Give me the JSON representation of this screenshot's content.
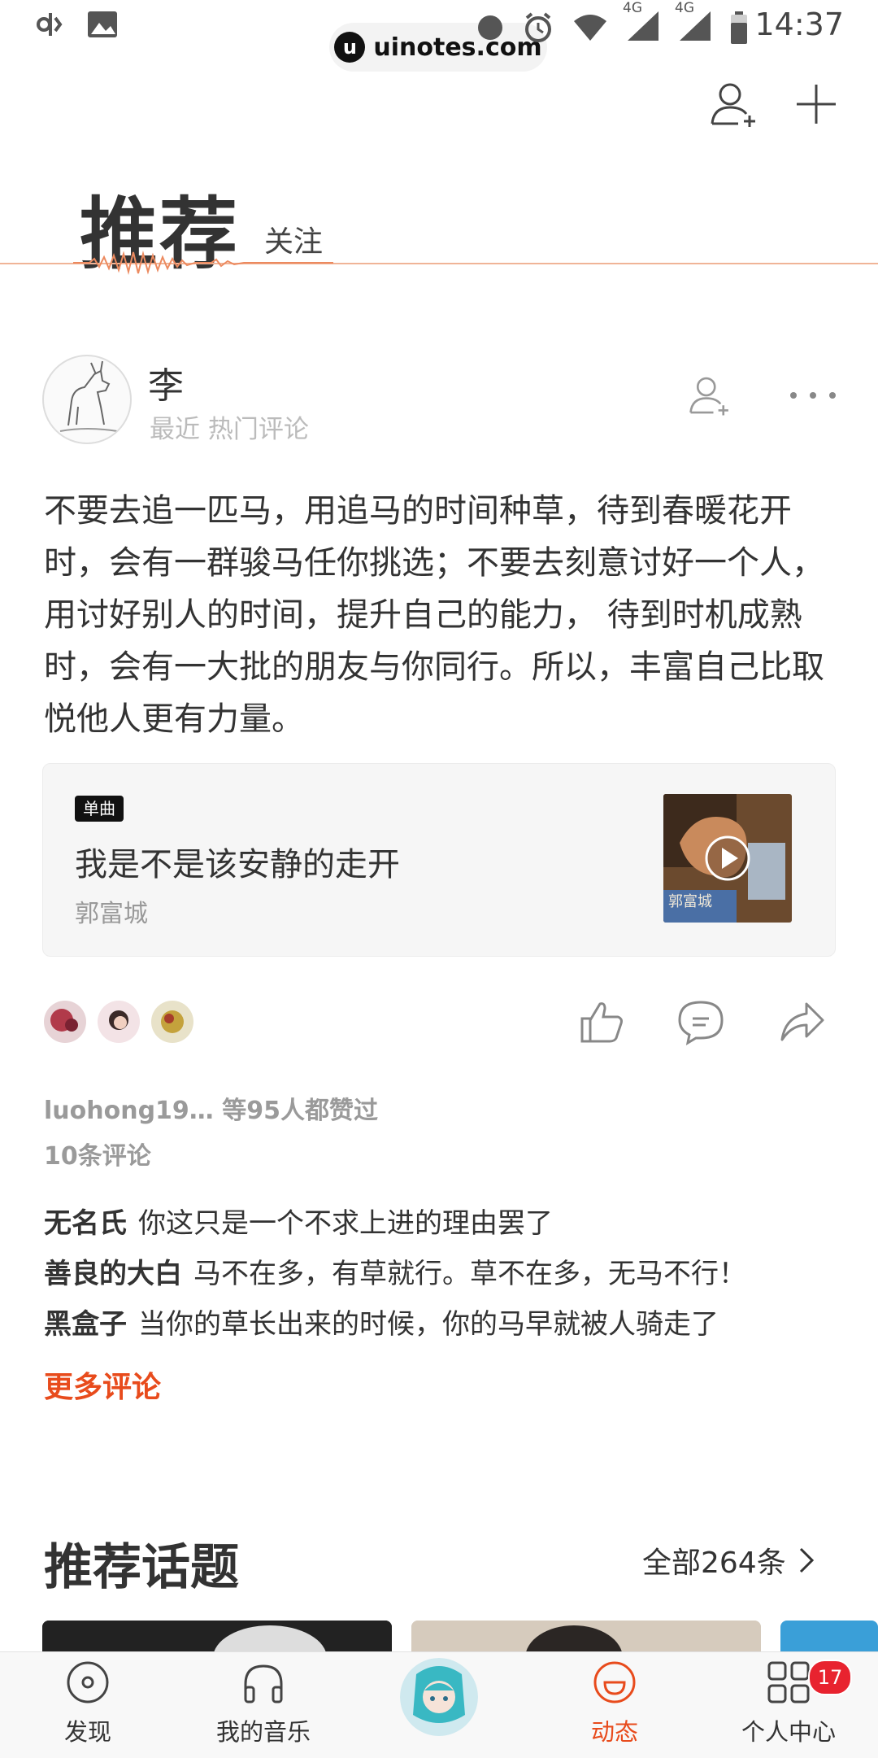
{
  "status_bar": {
    "time": "14:37",
    "network_1": "4G",
    "network_2": "4G",
    "watermark": "uinotes.com",
    "icons": [
      "voicemail-icon",
      "image-icon",
      "moon-icon",
      "alarm-icon",
      "wifi-icon",
      "signal-icon",
      "battery-icon"
    ]
  },
  "header": {
    "add_friend_icon": "add-user-icon",
    "add_icon": "plus-icon"
  },
  "tabs": {
    "active": "推荐",
    "inactive": "关注"
  },
  "post": {
    "username": "李",
    "meta": "最近 热门评论",
    "text": "不要去追一匹马，用追马的时间种草，待到春暖花开时，会有一群骏马任你挑选；不要去刻意讨好一个人，用讨好别人的时间，提升自己的能力， 待到时机成熟时，会有一大批的朋友与你同行。所以，丰富自己比取悦他人更有力量。",
    "song": {
      "tag": "单曲",
      "title": "我是不是该安静的走开",
      "artist": "郭富城",
      "cover_text": "郭富城"
    },
    "likes": "luohong19… 等95人都赞过",
    "comments_count": "10条评论",
    "comments": [
      {
        "name": "无名氏",
        "text": "你这只是一个不求上进的理由罢了"
      },
      {
        "name": "善良的大白",
        "text": "马不在多，有草就行。草不在多，无马不行！"
      },
      {
        "name": "黑盒子",
        "text": "当你的草长出来的时候，你的马早就被人骑走了"
      }
    ],
    "more_comments": "更多评论"
  },
  "topics": {
    "title": "推荐话题",
    "all_label": "全部264条"
  },
  "bottom_nav": {
    "items": [
      {
        "label": "发现",
        "icon": "disc-icon"
      },
      {
        "label": "我的音乐",
        "icon": "headphones-icon"
      },
      {
        "label": "",
        "icon": "now-playing-avatar"
      },
      {
        "label": "动态",
        "icon": "smile-icon"
      },
      {
        "label": "个人中心",
        "icon": "grid-icon"
      }
    ],
    "badge": "17"
  },
  "colors": {
    "accent": "#e84b1c",
    "badge": "#e8232f",
    "tab_line": "#f0b497"
  }
}
